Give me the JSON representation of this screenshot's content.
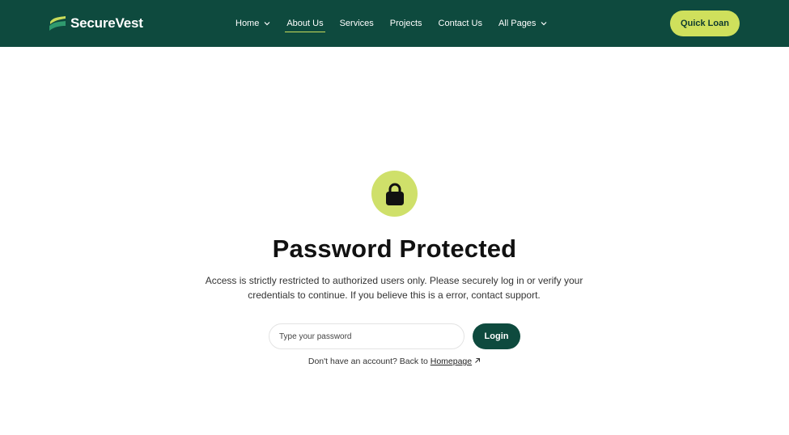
{
  "header": {
    "brand": "SecureVest",
    "nav": [
      {
        "label": "Home",
        "has_dropdown": true,
        "active": false
      },
      {
        "label": "About Us",
        "has_dropdown": false,
        "active": true
      },
      {
        "label": "Services",
        "has_dropdown": false,
        "active": false
      },
      {
        "label": "Projects",
        "has_dropdown": false,
        "active": false
      },
      {
        "label": "Contact Us",
        "has_dropdown": false,
        "active": false
      },
      {
        "label": "All Pages",
        "has_dropdown": true,
        "active": false
      }
    ],
    "cta_label": "Quick Loan"
  },
  "main": {
    "icon": "lock-icon",
    "title": "Password Protected",
    "description": "Access is strictly restricted to authorized users only. Please securely log in or verify your credentials to continue. If you believe this is a error, contact support.",
    "password_placeholder": "Type your password",
    "password_value": "",
    "login_label": "Login",
    "back_prefix": "Don't have an account? Back to ",
    "back_link": "Homepage"
  },
  "colors": {
    "header_bg": "#0e4a3e",
    "accent": "#cfe05c",
    "primary_button": "#0e4a3e"
  }
}
